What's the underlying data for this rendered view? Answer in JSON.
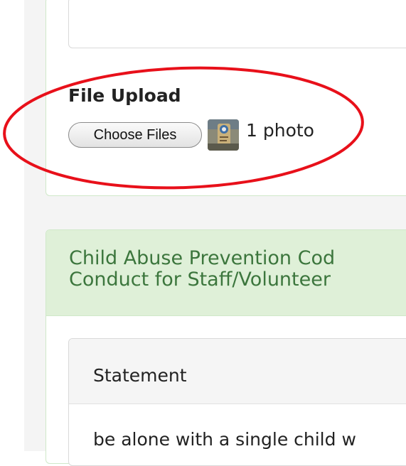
{
  "file_upload": {
    "label": "File Upload",
    "button_label": "Choose Files",
    "thumbnail_icon": "photo-thumbnail-icon",
    "file_count": "1 photo"
  },
  "section": {
    "title_line1": "Child Abuse Prevention Cod",
    "title_line2": "Conduct for Staff/Volunteer",
    "statement_label": "Statement",
    "statement_text": "be alone with a single child w"
  },
  "annotation": {
    "color": "#e8101a"
  },
  "colors": {
    "panel_border": "#cfe8c9",
    "section_header_bg": "#dff0d8",
    "section_title": "#3c763d"
  }
}
